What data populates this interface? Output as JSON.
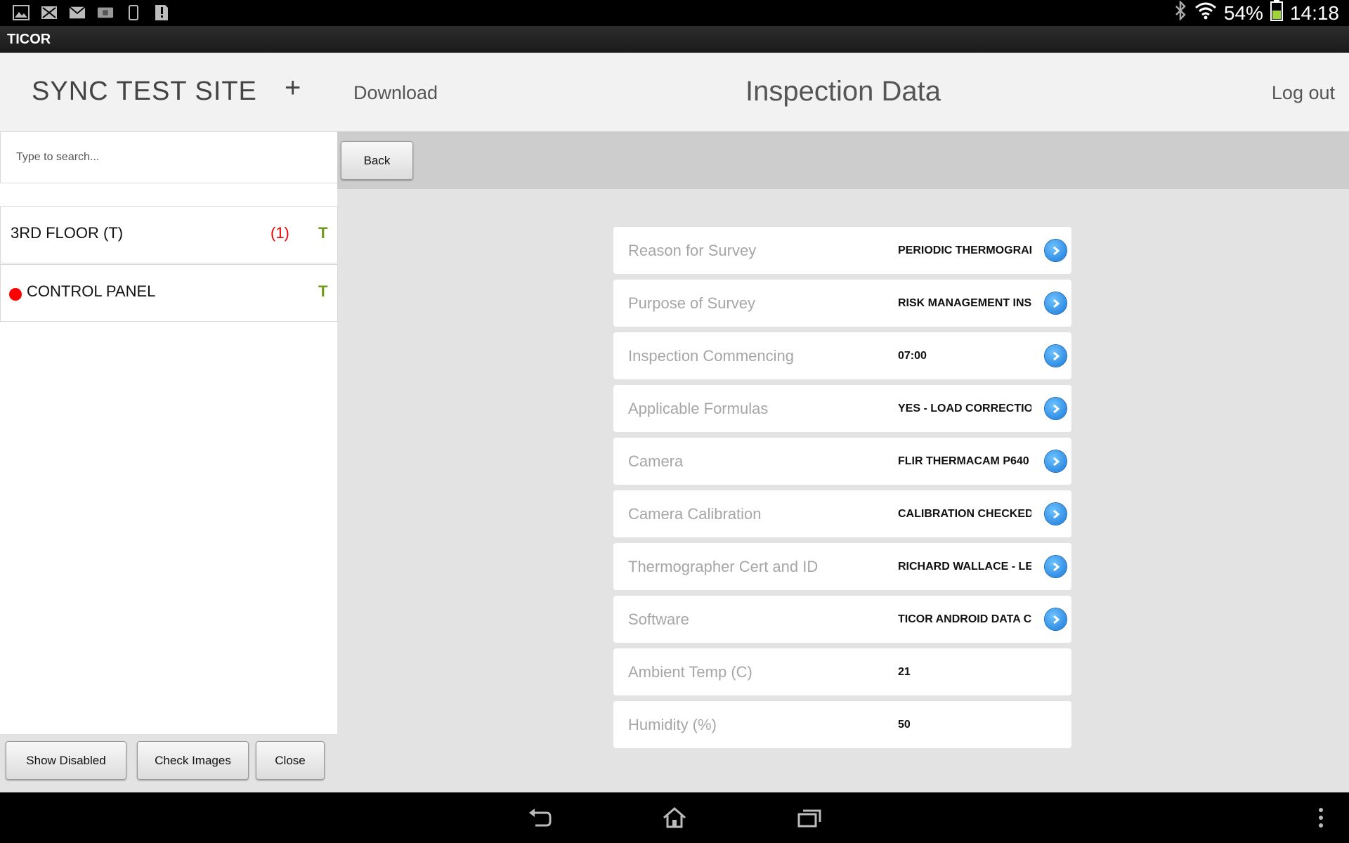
{
  "status_bar": {
    "left_icons": [
      "image-icon",
      "missed-mail-icon",
      "mail-icon",
      "sim-card-icon",
      "phone-icon",
      "sd-card-alert-icon"
    ],
    "battery": "54%",
    "time": "14:18"
  },
  "app": {
    "title": "TICOR"
  },
  "sidebar": {
    "site_title": "SYNC TEST SITE",
    "add_label": "+",
    "search_placeholder": "Type to search...",
    "items": [
      {
        "label": "3RD FLOOR (T)",
        "count": "(1)",
        "tag": "T",
        "alert": false
      },
      {
        "label": "CONTROL PANEL",
        "count": "",
        "tag": "T",
        "alert": true
      }
    ],
    "footer_buttons": {
      "show_disabled": "Show Disabled",
      "check_images": "Check Images",
      "close": "Close"
    }
  },
  "header": {
    "download_label": "Download",
    "title": "Inspection Data",
    "logout_label": "Log out"
  },
  "toolbar": {
    "back_label": "Back"
  },
  "inspection_rows": [
    {
      "label": "Reason for Survey",
      "value": "PERIODIC THERMOGRAP",
      "has_action": true
    },
    {
      "label": "Purpose of Survey",
      "value": "RISK MANAGEMENT INS",
      "has_action": true
    },
    {
      "label": "Inspection Commencing",
      "value": "07:00",
      "has_action": true
    },
    {
      "label": "Applicable Formulas",
      "value": "YES - LOAD CORRECTIOI",
      "has_action": true
    },
    {
      "label": "Camera",
      "value": "FLIR THERMACAM P640",
      "has_action": true
    },
    {
      "label": "Camera Calibration",
      "value": "CALIBRATION CHECKED",
      "has_action": true
    },
    {
      "label": "Thermographer Cert and ID",
      "value": "RICHARD WALLACE - LEV",
      "has_action": true
    },
    {
      "label": "Software",
      "value": "TICOR ANDROID DATA C/",
      "has_action": true
    },
    {
      "label": "Ambient Temp (C)",
      "value": "21",
      "has_action": false
    },
    {
      "label": "Humidity (%)",
      "value": "50",
      "has_action": false
    }
  ],
  "colors": {
    "status_bar_bg": "#000000",
    "header_bg": "#f2f2f2",
    "toolbar_bg": "#cdcdcd",
    "content_bg": "#e3e3e3",
    "alert_red": "#ff0000",
    "tag_green": "#6f9a1a",
    "accent_blue": "#1878d8"
  }
}
